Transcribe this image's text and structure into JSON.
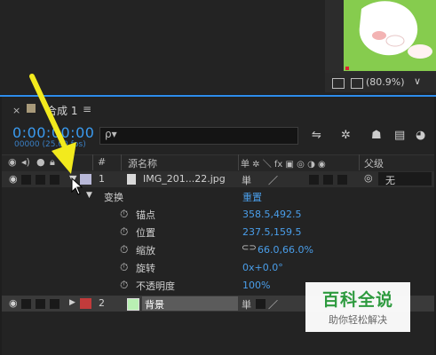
{
  "viewer": {
    "zoom": "(80.9%)"
  },
  "panel": {
    "tab_title": "合成 1",
    "timecode": "0:00:00:00",
    "frames": "00000 (25.00 fps)",
    "search_placeholder": "ρ▾"
  },
  "columns": {
    "hash": "#",
    "source_name": "源名称",
    "switches": "单 ✲ ＼ fx ▣ ◎ ◑ ◉",
    "parent": "父级"
  },
  "layers": [
    {
      "num": "1",
      "name": "IMG_201...22.jpg",
      "parent": "无",
      "label_color": "#b8b8d8"
    },
    {
      "num": "2",
      "name": "背景",
      "label_color": "#c23b3b"
    }
  ],
  "transform": {
    "label": "变换",
    "reset": "重置",
    "props": [
      {
        "name": "锚点",
        "value": "358.5,492.5"
      },
      {
        "name": "位置",
        "value": "237.5,159.5"
      },
      {
        "name": "缩放",
        "value": "66.0,66.0%"
      },
      {
        "name": "旋转",
        "value": "0x+0.0°"
      },
      {
        "name": "不透明度",
        "value": "100%"
      }
    ]
  },
  "watermark": {
    "title": "百科全说",
    "subtitle": "助你轻松解决"
  },
  "colors": {
    "accent": "#2d8ceb",
    "value_blue": "#4a9eea",
    "arrow": "#f2ea1d"
  }
}
